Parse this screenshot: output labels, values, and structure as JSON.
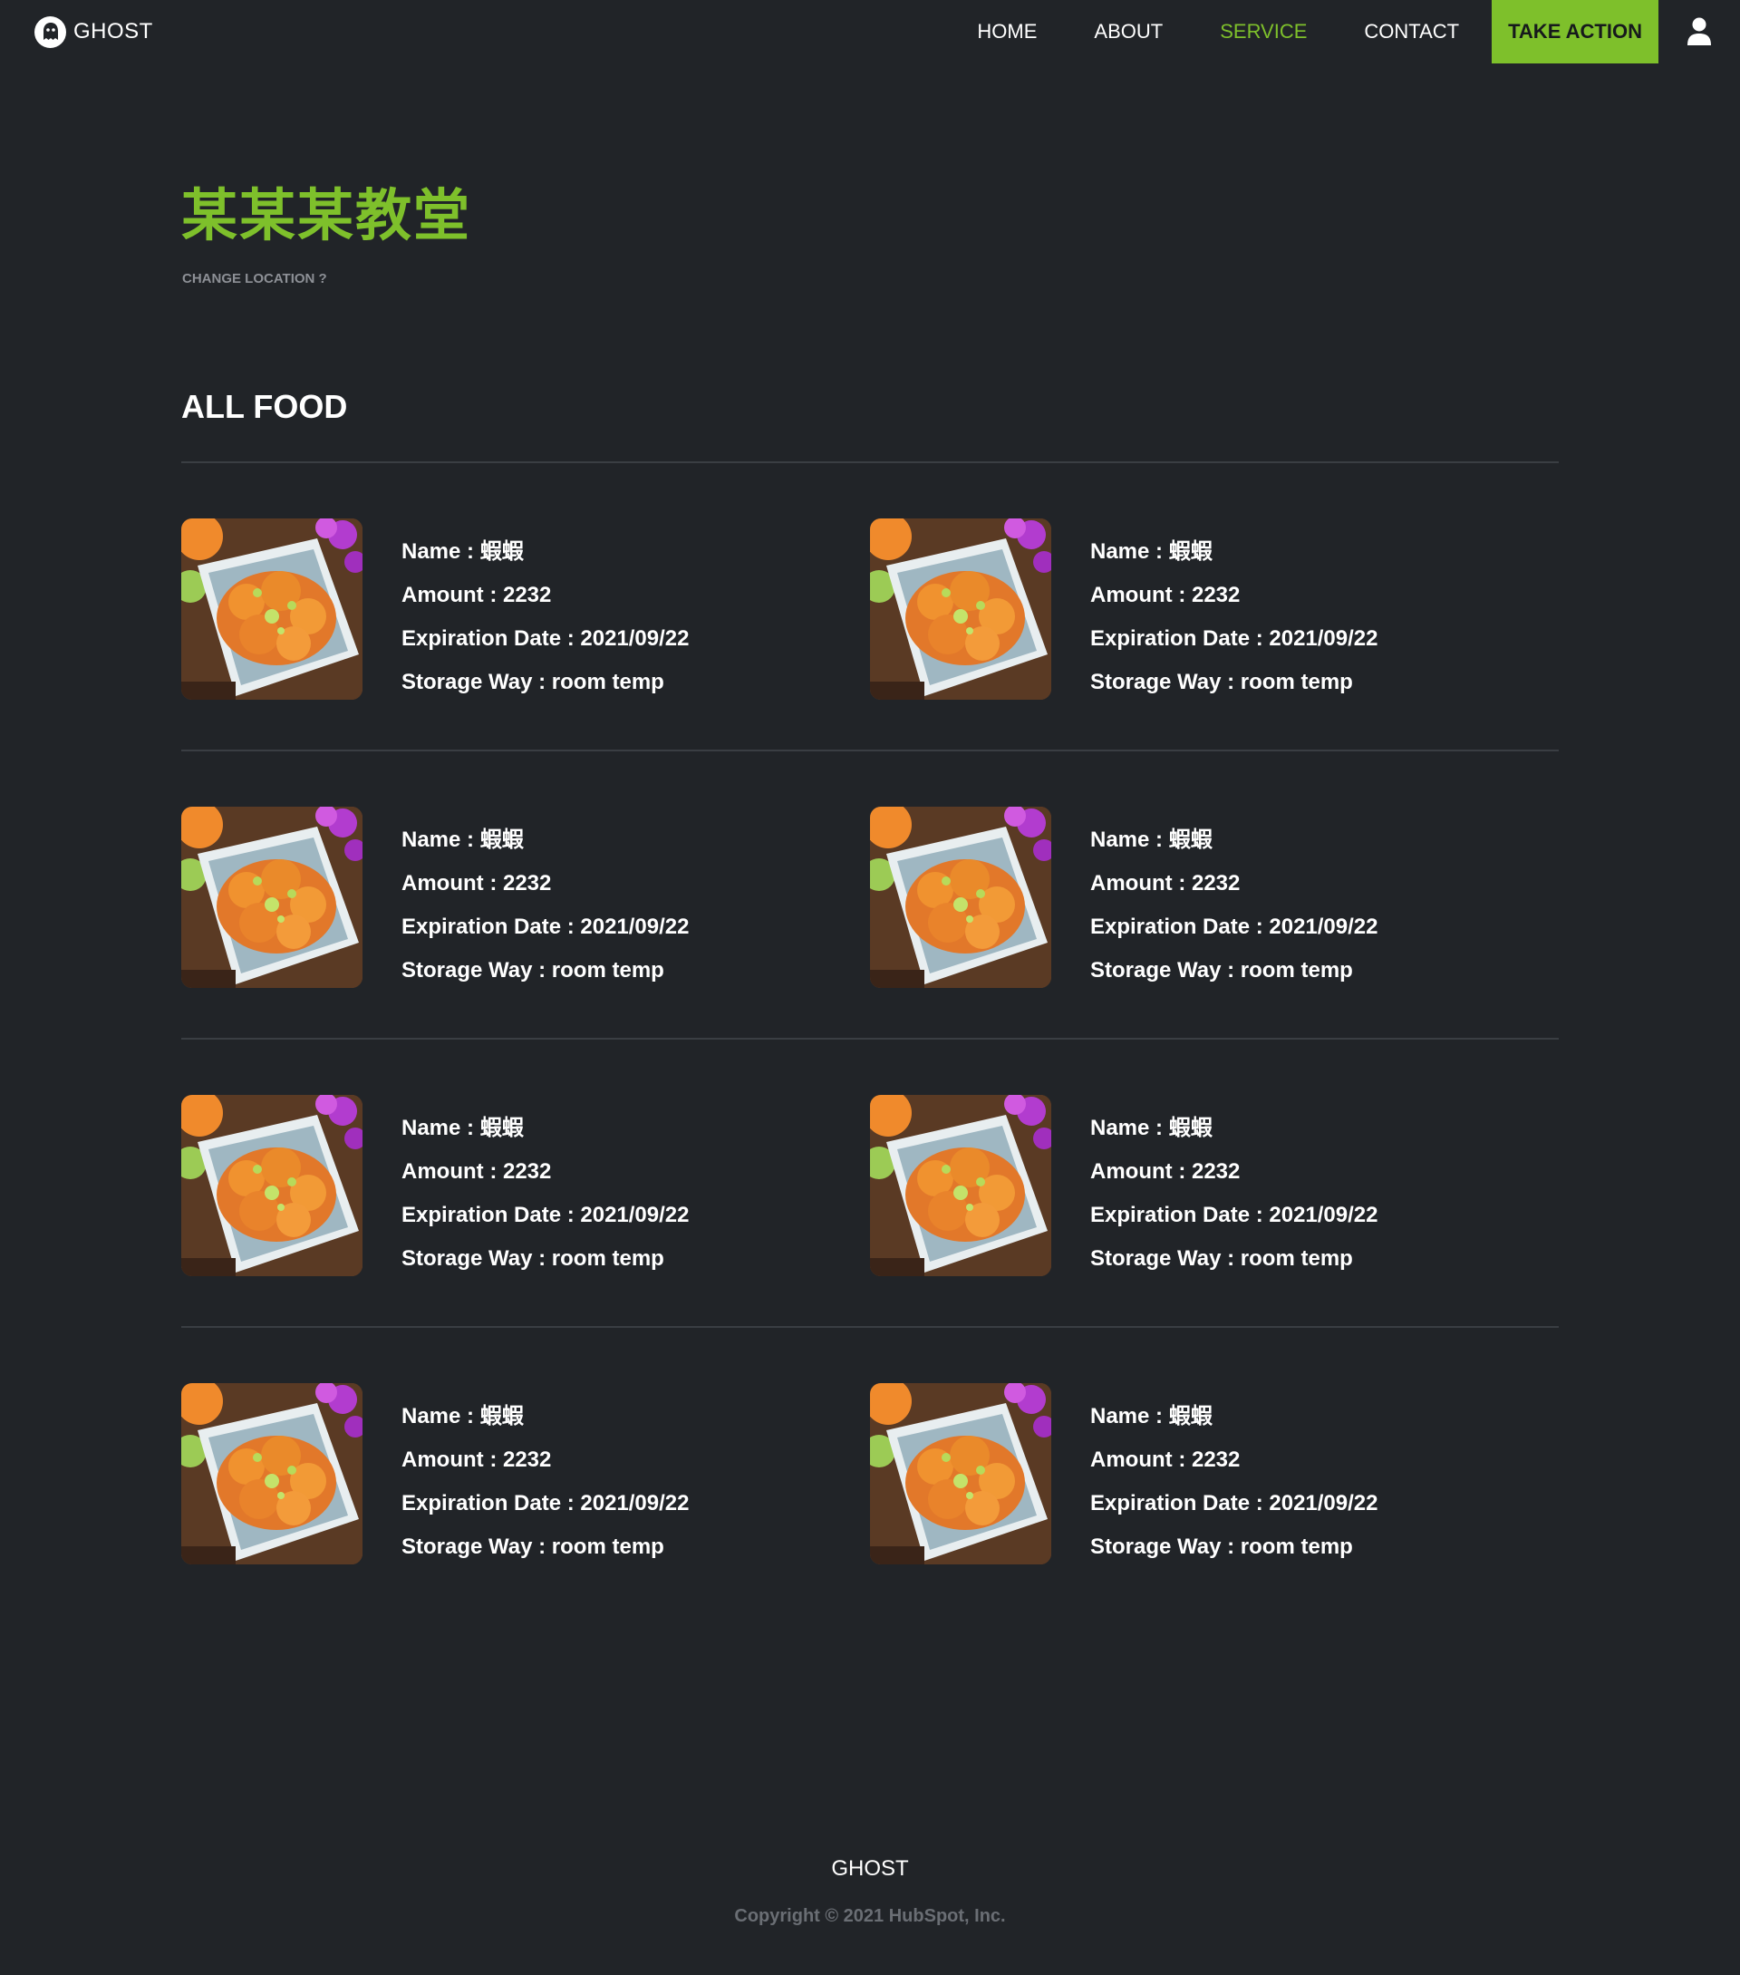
{
  "nav": {
    "brand": "GHOST",
    "links": [
      "HOME",
      "ABOUT",
      "SERVICE",
      "CONTACT"
    ],
    "active_link": "SERVICE",
    "cta_label": "TAKE ACTION",
    "user_icon": "user-icon"
  },
  "header": {
    "location_name": "某某某教堂",
    "change_location": "CHANGE LOCATION ?"
  },
  "section": {
    "title": "ALL FOOD"
  },
  "food_items": [
    {
      "name": "Name : 蝦蝦",
      "amount": "Amount : 2232",
      "expiration": "Expiration Date : 2021/09/22",
      "storage": "Storage Way : room temp"
    },
    {
      "name": "Name : 蝦蝦",
      "amount": "Amount : 2232",
      "expiration": "Expiration Date : 2021/09/22",
      "storage": "Storage Way : room temp"
    },
    {
      "name": "Name : 蝦蝦",
      "amount": "Amount : 2232",
      "expiration": "Expiration Date : 2021/09/22",
      "storage": "Storage Way : room temp"
    },
    {
      "name": "Name : 蝦蝦",
      "amount": "Amount : 2232",
      "expiration": "Expiration Date : 2021/09/22",
      "storage": "Storage Way : room temp"
    },
    {
      "name": "Name : 蝦蝦",
      "amount": "Amount : 2232",
      "expiration": "Expiration Date : 2021/09/22",
      "storage": "Storage Way : room temp"
    },
    {
      "name": "Name : 蝦蝦",
      "amount": "Amount : 2232",
      "expiration": "Expiration Date : 2021/09/22",
      "storage": "Storage Way : room temp"
    },
    {
      "name": "Name : 蝦蝦",
      "amount": "Amount : 2232",
      "expiration": "Expiration Date : 2021/09/22",
      "storage": "Storage Way : room temp"
    },
    {
      "name": "Name : 蝦蝦",
      "amount": "Amount : 2232",
      "expiration": "Expiration Date : 2021/09/22",
      "storage": "Storage Way : room temp"
    }
  ],
  "footer": {
    "brand": "GHOST",
    "copyright": "Copyright © 2021 HubSpot, Inc."
  },
  "colors": {
    "background": "#212428",
    "accent": "#7ec02b",
    "divider": "#3a3e43",
    "muted_text": "#8d9096"
  }
}
